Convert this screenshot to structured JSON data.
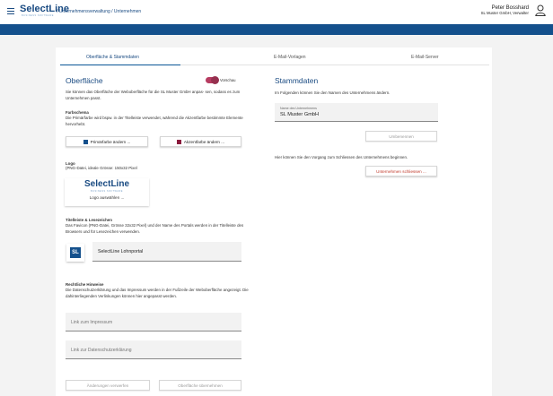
{
  "header": {
    "brand": "SelectLine",
    "brand_sub": "BUSINESS SOFTWARE",
    "breadcrumb": "/ Unternehmensverwaltung / Unternehmen",
    "user_name": "Peter Bosshard",
    "user_company": "SL Muster GmbH, Verwalter"
  },
  "tabs": [
    {
      "label": "Oberfläche & Stammdaten",
      "active": true
    },
    {
      "label": "E-Mail-Vorlagen",
      "active": false
    },
    {
      "label": "E-Mail-Server",
      "active": false
    }
  ],
  "left": {
    "title": "Oberfläche",
    "preview_toggle_label": "Vorschau",
    "intro": "Sie können das Oberfläche der Weboberfläche für die SL Muster GmbH anpas- sen, sodass es zum Unternehmen passt.",
    "color_scheme_heading": "Farbschema",
    "color_scheme_text": "Die Primärfarbe wird bspw. in der Titelleiste verwendet, während die Akzentfarbe bestimmte Elemente hervorhebt.",
    "primary_button": "Primärfarbe ändern ...",
    "accent_button": "Akzentfarbe ändern ...",
    "primary_color": "#14508c",
    "accent_color": "#8b1a3d",
    "logo_heading": "Logo",
    "logo_text": "(PNG-Datei, ideale Grösse: 150x32 Pixel",
    "logo_brand": "SelectLine",
    "logo_brand_sub": "BUSINESS SOFTWARE",
    "logo_button": "Logo auswählen ...",
    "title_heading": "Titelleiste & Lesezeichen",
    "title_text": "Das Favicon (PNG-Datei, Grösse 32x32 Pixel) und der Name des Portals werden in der Titelleiste des Browsers und für Lesezeichen verwenden.",
    "favicon_text": "SL",
    "portal_name": "SelectLine Lohnportal",
    "legal_heading": "Rechtliche Hinweise",
    "legal_text": "Die Datenschutzerklärung und das Impressum werden in der Fußzeile der Weboberfläche angezeigt. Die dahinterliegenden Verlinkungen können hier angepasst werden.",
    "impressum_placeholder": "Link zum Impressum",
    "datenschutz_placeholder": "Link zur Datenschutzerklärung",
    "discard_button": "Änderungen verwerfen",
    "apply_button": "Oberfläche übernehmen"
  },
  "right": {
    "title": "Stammdaten",
    "intro": "Im Folgenden können Sie den Namen des Unternehmens ändern.",
    "company_label": "Name des Unternehmens",
    "company_value": "SL Muster GmbH",
    "rename_button": "Umbenennen",
    "close_text": "Hier können Sie den Vorgang zum Schliessen des Unternehmens beginnen.",
    "close_button": "Unternehmen schliessen ..."
  }
}
